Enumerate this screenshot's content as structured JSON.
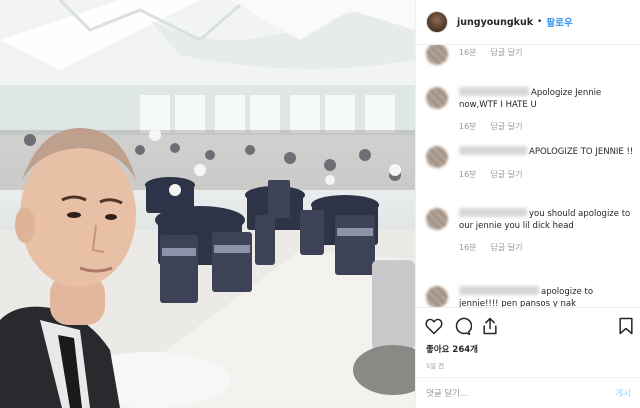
{
  "post": {
    "image_alt": "Selfie at a wedding banquet hall"
  },
  "header": {
    "username": "jungyoungkuk",
    "separator": "•",
    "follow_label": "팔로우"
  },
  "comments": [
    {
      "text": "",
      "time": "16분",
      "reply_label": "답글 달기"
    },
    {
      "text": "Apologize Jennie now,WTF I HATE U",
      "time": "16분",
      "reply_label": "답글 달기"
    },
    {
      "text": "APOLOGIZE TO JENNIE !!",
      "time": "16분",
      "reply_label": "답글 달기"
    },
    {
      "text": "you should apologize to our jennie you lil dick head",
      "time": "16분",
      "reply_label": "답글 달기"
    },
    {
      "text": "apologize to jennie!!!! pen pansos y nak",
      "time": "",
      "reply_label": ""
    }
  ],
  "actions": {
    "likes": "좋아요 264개",
    "timestamp": "5일 전"
  },
  "add_comment": {
    "placeholder": "댓글 달기...",
    "post_label": "게시"
  },
  "colors": {
    "link_blue": "#3897f0",
    "post_disabled": "#b2dffc",
    "text": "#262626",
    "muted": "#999999"
  }
}
